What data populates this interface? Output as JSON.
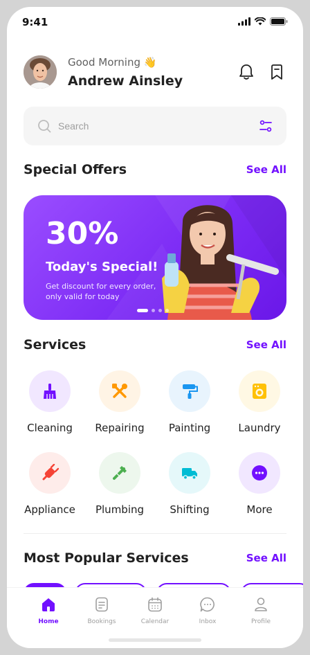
{
  "status": {
    "time": "9:41"
  },
  "header": {
    "greeting": "Good Morning 👋",
    "user_name": "Andrew Ainsley"
  },
  "search": {
    "placeholder": "Search"
  },
  "special_offers": {
    "title": "Special Offers",
    "see_all": "See All",
    "banner": {
      "discount": "30%",
      "headline": "Today's Special!",
      "description": "Get discount for every order, only valid for today",
      "active_slide": 1,
      "total_slides": 4
    }
  },
  "services": {
    "title": "Services",
    "see_all": "See All",
    "items": [
      {
        "label": "Cleaning",
        "icon": "broom-icon",
        "color": "#7210ff",
        "bg": "#f1e7ff"
      },
      {
        "label": "Repairing",
        "icon": "tools-icon",
        "color": "#ff9800",
        "bg": "#fff4e5"
      },
      {
        "label": "Painting",
        "icon": "roller-icon",
        "color": "#1a96f0",
        "bg": "#e8f4fd"
      },
      {
        "label": "Laundry",
        "icon": "washer-icon",
        "color": "#ffc107",
        "bg": "#fff8e4"
      },
      {
        "label": "Appliance",
        "icon": "plug-icon",
        "color": "#f54336",
        "bg": "#feecea"
      },
      {
        "label": "Plumbing",
        "icon": "wrench-icon",
        "color": "#4caf50",
        "bg": "#edf7ed"
      },
      {
        "label": "Shifting",
        "icon": "truck-icon",
        "color": "#00bcd4",
        "bg": "#e5f8fa"
      },
      {
        "label": "More",
        "icon": "more-icon",
        "color": "#7210ff",
        "bg": "#f1e7ff"
      }
    ]
  },
  "popular": {
    "title": "Most Popular Services",
    "see_all": "See All"
  },
  "tabbar": {
    "items": [
      {
        "label": "Home",
        "icon": "home-icon",
        "active": true
      },
      {
        "label": "Bookings",
        "icon": "document-icon",
        "active": false
      },
      {
        "label": "Calendar",
        "icon": "calendar-icon",
        "active": false
      },
      {
        "label": "Inbox",
        "icon": "chat-icon",
        "active": false
      },
      {
        "label": "Profile",
        "icon": "profile-icon",
        "active": false
      }
    ]
  },
  "colors": {
    "accent": "#7210ff",
    "text": "#212121",
    "muted": "#9e9e9e"
  }
}
